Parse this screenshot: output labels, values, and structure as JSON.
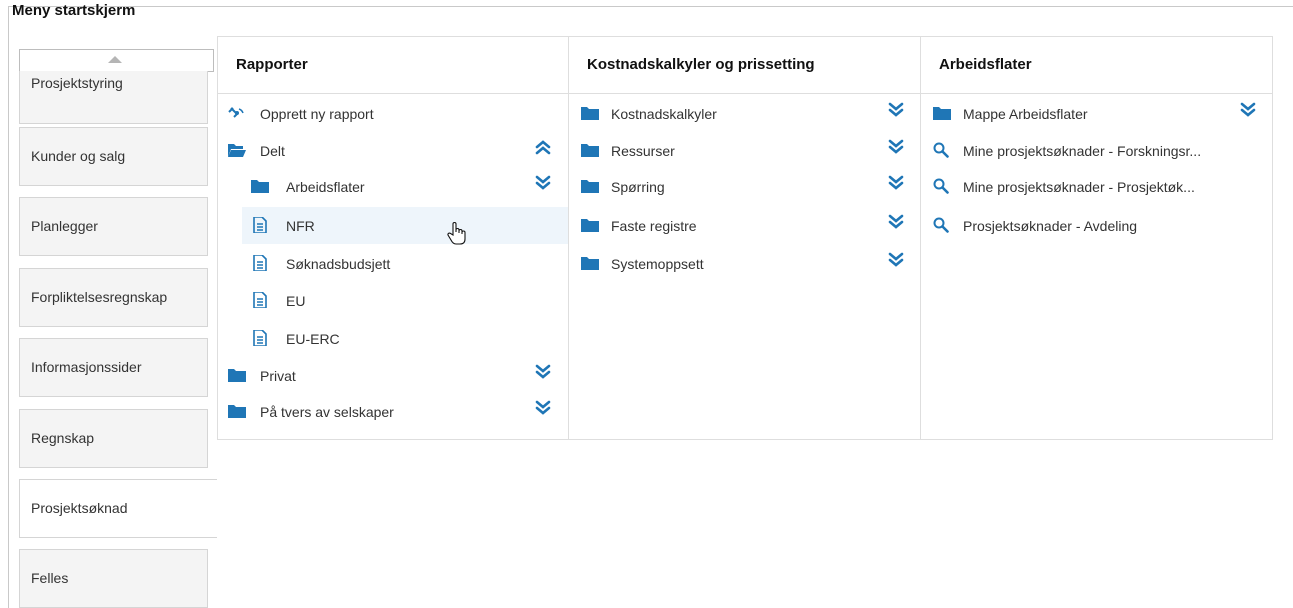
{
  "window": {
    "title": "Meny startskjerm"
  },
  "sidebar": {
    "tabs": [
      {
        "label": "Prosjektstyring"
      },
      {
        "label": "Kunder og salg"
      },
      {
        "label": "Planlegger"
      },
      {
        "label": "Forpliktelsesregnskap"
      },
      {
        "label": "Informasjonssider"
      },
      {
        "label": "Regnskap"
      },
      {
        "label": "Prosjektsøknad"
      },
      {
        "label": "Felles"
      }
    ],
    "active": "Prosjektsøknad"
  },
  "columns": {
    "rapporter": {
      "header": "Rapporter",
      "items": [
        {
          "label": "Opprett ny rapport",
          "icon": "satellite-icon"
        },
        {
          "label": "Delt",
          "icon": "folder-open-icon",
          "toggle": "collapse"
        },
        {
          "label": "Arbeidsflater",
          "icon": "folder-icon",
          "toggle": "expand"
        },
        {
          "label": "NFR",
          "icon": "document-icon"
        },
        {
          "label": "Søknadsbudsjett",
          "icon": "document-icon"
        },
        {
          "label": "EU",
          "icon": "document-icon"
        },
        {
          "label": "EU-ERC",
          "icon": "document-icon"
        },
        {
          "label": "Privat",
          "icon": "folder-icon",
          "toggle": "expand"
        },
        {
          "label": "På tvers av selskaper",
          "icon": "folder-icon",
          "toggle": "expand"
        }
      ]
    },
    "kostnad": {
      "header": "Kostnadskalkyler og prissetting",
      "items": [
        {
          "label": "Kostnadskalkyler",
          "icon": "folder-icon",
          "toggle": "expand"
        },
        {
          "label": "Ressurser",
          "icon": "folder-icon",
          "toggle": "expand"
        },
        {
          "label": "Spørring",
          "icon": "folder-icon",
          "toggle": "expand"
        },
        {
          "label": "Faste registre",
          "icon": "folder-icon",
          "toggle": "expand"
        },
        {
          "label": "Systemoppsett",
          "icon": "folder-icon",
          "toggle": "expand"
        }
      ]
    },
    "arbeidsflater": {
      "header": "Arbeidsflater",
      "items": [
        {
          "label": "Mappe Arbeidsflater",
          "icon": "folder-icon",
          "toggle": "expand"
        },
        {
          "label": "Mine prosjektsøknader - Forskningsr...",
          "icon": "search-icon"
        },
        {
          "label": "Mine prosjektsøknader - Prosjektøk...",
          "icon": "search-icon"
        },
        {
          "label": "Prosjektsøknader - Avdeling",
          "icon": "search-icon"
        }
      ]
    }
  },
  "colors": {
    "accent": "#1f76b6",
    "highlight": "#eef5fb",
    "tab_bg": "#f4f4f4"
  }
}
